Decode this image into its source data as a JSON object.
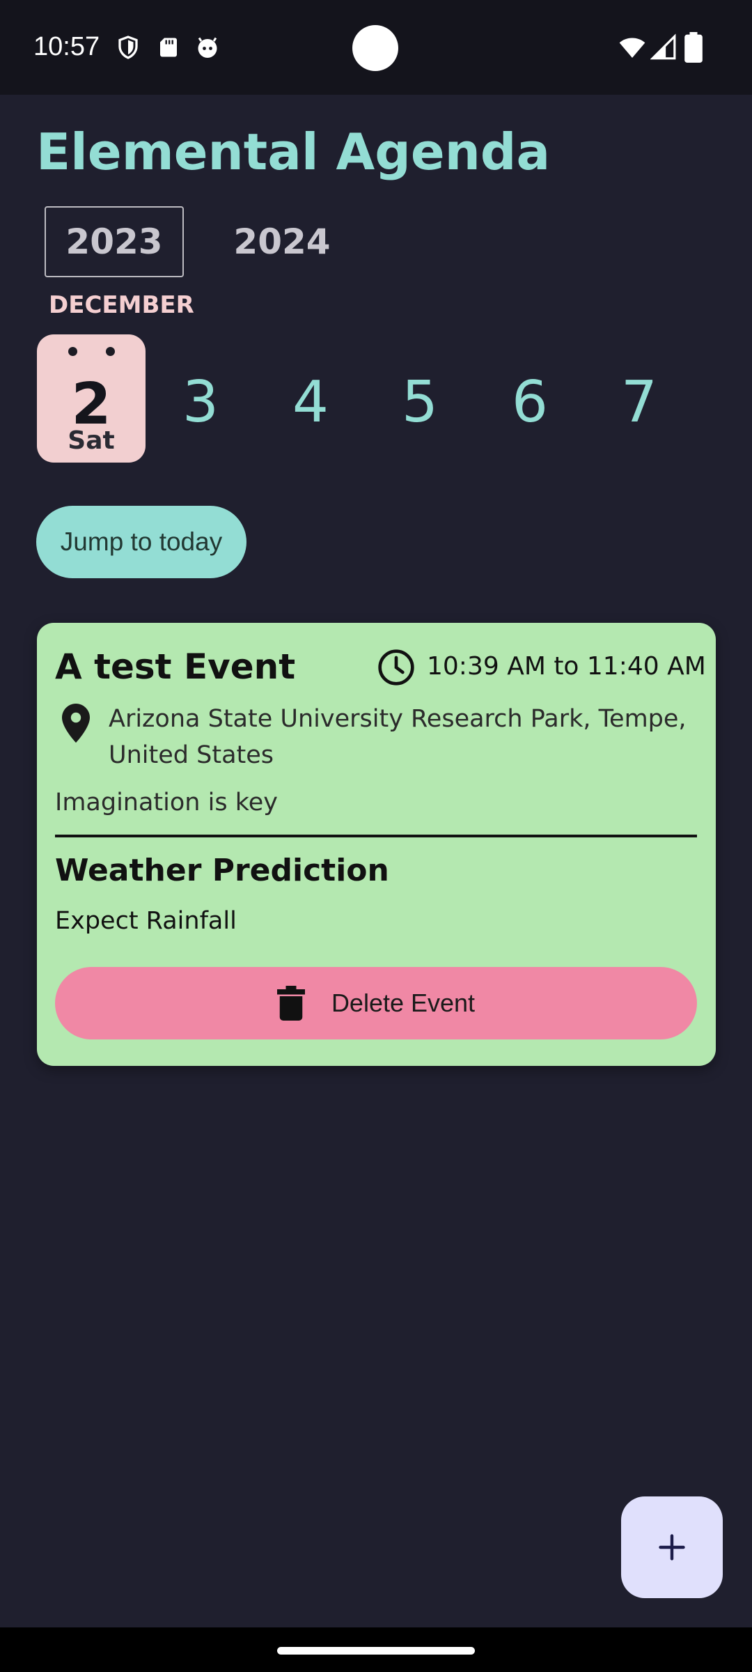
{
  "status_bar": {
    "time": "10:57",
    "left_icons": [
      "shield-icon",
      "sd-card-icon",
      "android-face-icon"
    ],
    "right_icons": [
      "wifi-icon",
      "signal-icon",
      "battery-icon"
    ]
  },
  "app": {
    "title": "Elemental Agenda",
    "accent_color": "#93ddd4"
  },
  "years": {
    "selected": "2023",
    "other": "2024"
  },
  "month": "DECEMBER",
  "days": [
    {
      "number": "2",
      "weekday": "Sat",
      "selected": true
    },
    {
      "number": "3",
      "selected": false
    },
    {
      "number": "4",
      "selected": false
    },
    {
      "number": "5",
      "selected": false
    },
    {
      "number": "6",
      "selected": false
    },
    {
      "number": "7",
      "selected": false
    }
  ],
  "jump_button_label": "Jump to today",
  "event": {
    "title": "A test Event",
    "time": "10:39 AM to 11:40 AM",
    "location": "Arizona State University Research Park, Tempe, United States",
    "description": "Imagination is key",
    "weather_heading": "Weather Prediction",
    "weather_text": "Expect Rainfall",
    "delete_label": "Delete Event",
    "card_color": "#b4e8b0",
    "delete_color": "#f088a5"
  },
  "fab": {
    "icon": "plus-icon"
  }
}
